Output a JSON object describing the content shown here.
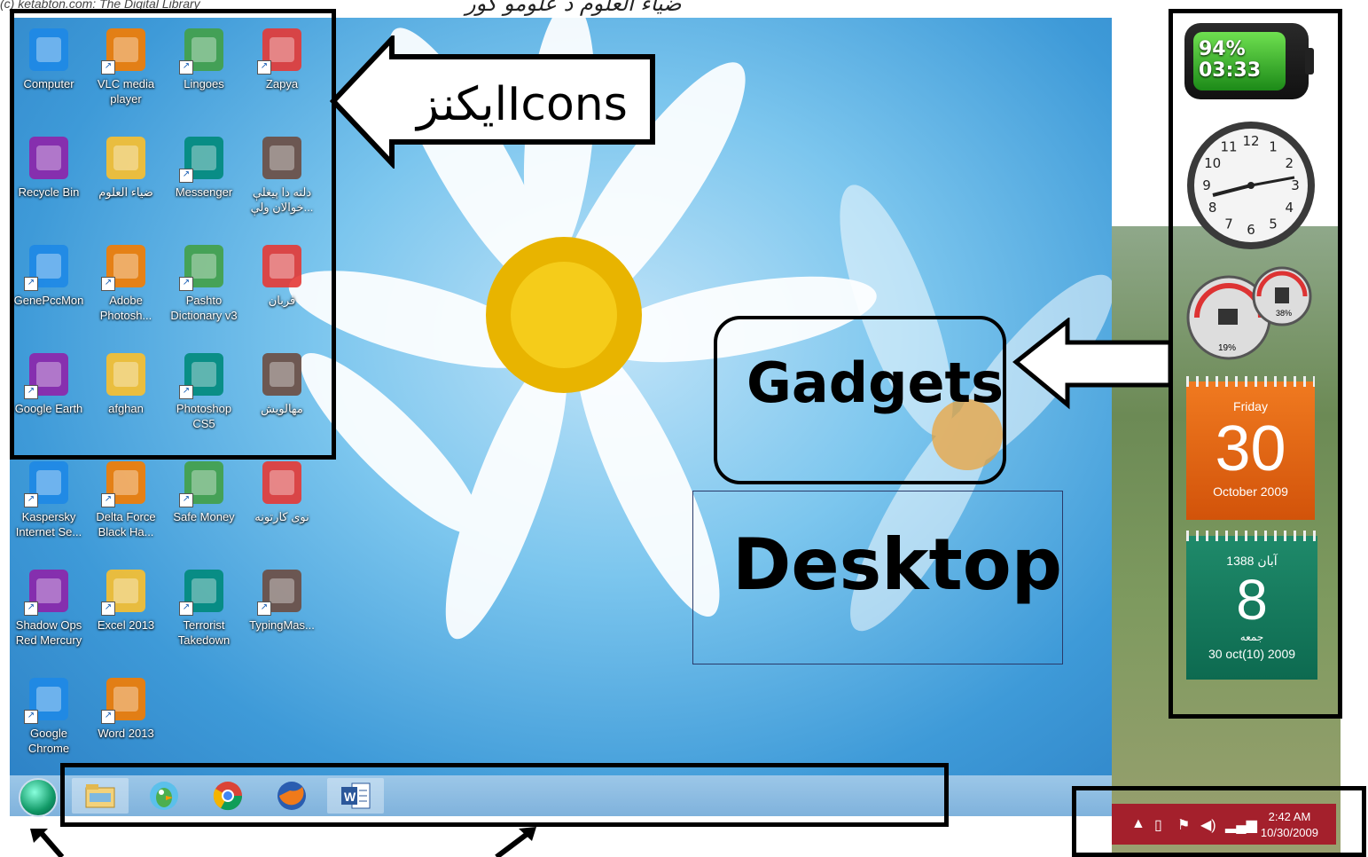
{
  "header": {
    "watermark": "(c) ketabton.com: The Digital Library",
    "title": "ضیاء العلوم د علومو کور"
  },
  "desktop_icons": [
    {
      "label": "Computer",
      "icon": "computer-icon"
    },
    {
      "label": "VLC media player",
      "icon": "vlc-icon"
    },
    {
      "label": "Lingoes",
      "icon": "lingoes-icon"
    },
    {
      "label": "Zapya",
      "icon": "zapya-icon"
    },
    {
      "label": "Recycle Bin",
      "icon": "recycle-bin-icon"
    },
    {
      "label": "ضیاء العلوم",
      "icon": "folder-icon"
    },
    {
      "label": "Messenger",
      "icon": "messenger-icon"
    },
    {
      "label": "دلته دا پیغلې خوالان ولې...",
      "icon": "pdf-icon"
    },
    {
      "label": "GenePccMon",
      "icon": "gear-document-icon"
    },
    {
      "label": "Adobe Photosh...",
      "icon": "photoshop-eye-icon"
    },
    {
      "label": "Pashto Dictionary v3",
      "icon": "dictionary-icon"
    },
    {
      "label": "قربان",
      "icon": "word-collage-icon"
    },
    {
      "label": "Google Earth",
      "icon": "google-earth-icon"
    },
    {
      "label": "afghan",
      "icon": "afghan-flag-icon"
    },
    {
      "label": "Photoshop CS5",
      "icon": "photoshop-icon"
    },
    {
      "label": "مهالویش",
      "icon": "word-document-icon"
    },
    {
      "label": "Kaspersky Internet Se...",
      "icon": "kaspersky-icon"
    },
    {
      "label": "Delta Force Black Ha...",
      "icon": "soldier-icon"
    },
    {
      "label": "Safe Money",
      "icon": "safe-money-icon"
    },
    {
      "label": "نوی کارتونه",
      "icon": "pdf-collage-icon"
    },
    {
      "label": "Shadow Ops Red Mercury",
      "icon": "shadow-ops-icon"
    },
    {
      "label": "Excel 2013",
      "icon": "excel-icon"
    },
    {
      "label": "Terrorist Takedown",
      "icon": "terrorist-takedown-icon"
    },
    {
      "label": "TypingMas...",
      "icon": "typingmaster-icon"
    },
    {
      "label": "Google Chrome",
      "icon": "chrome-icon"
    },
    {
      "label": "Word 2013",
      "icon": "word-icon"
    }
  ],
  "taskbar": {
    "items": [
      {
        "icon": "start-orb-icon"
      },
      {
        "icon": "file-explorer-icon"
      },
      {
        "icon": "lingoes-icon"
      },
      {
        "icon": "chrome-icon"
      },
      {
        "icon": "firefox-icon"
      },
      {
        "icon": "word-icon"
      }
    ]
  },
  "tray": {
    "time": "2:42 AM",
    "date": "10/30/2009",
    "icons": [
      "show-hidden-icons-icon",
      "battery-icon",
      "action-center-flag-icon",
      "volume-icon",
      "network-signal-icon"
    ]
  },
  "gadgets": {
    "battery": {
      "percent": "94%",
      "time": "03:33"
    },
    "clock": {
      "numbers": [
        "12",
        "1",
        "2",
        "3",
        "4",
        "5",
        "6",
        "7",
        "8",
        "9",
        "10",
        "11"
      ]
    },
    "meters": {
      "cpu": "19%",
      "memory": "38%"
    },
    "calendar": {
      "day": "Friday",
      "date": "30",
      "month": "October 2009"
    },
    "calendar_persian": {
      "year": "آبان 1388",
      "date": "8",
      "weekday": "جمعه",
      "gregorian": "30 oct(10) 2009"
    }
  },
  "annotations": {
    "icons_label": "ایکنزIcons",
    "gadgets_label": "Gadgets",
    "desktop_label": "Desktop"
  },
  "colors": {
    "desktop_blue": "#3e9ad8",
    "tray_red": "#a4202c",
    "calendar_orange": "#e06615",
    "calendar_green": "#1f8a6a"
  }
}
